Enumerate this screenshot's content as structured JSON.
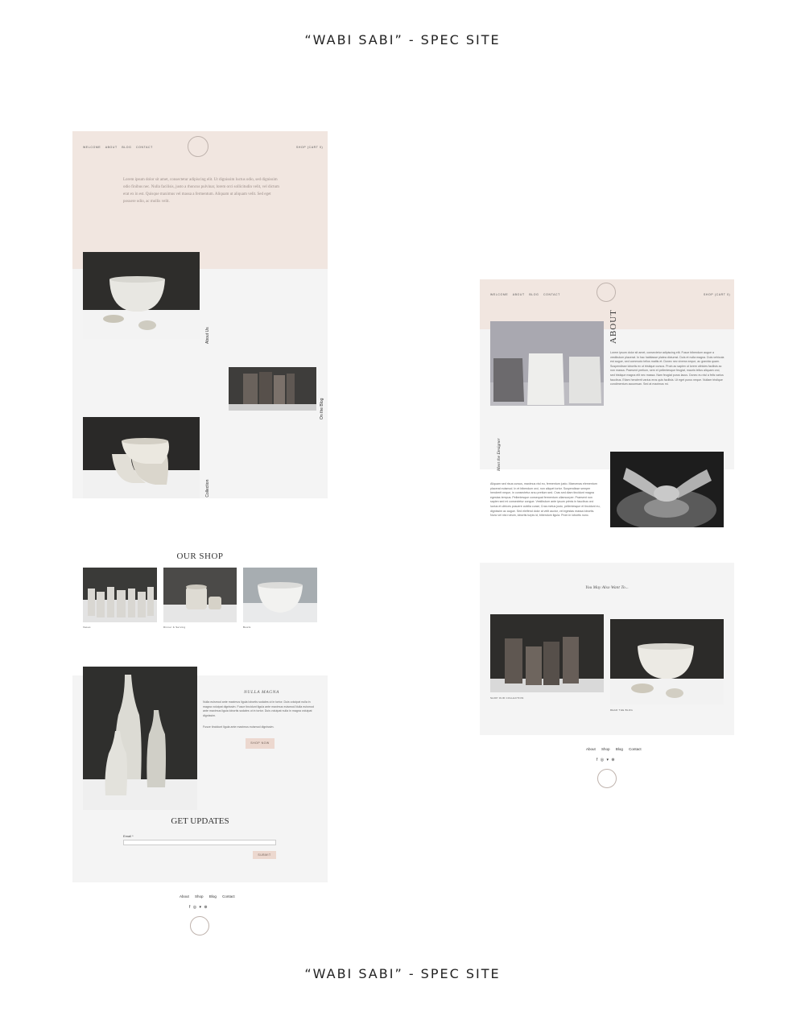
{
  "title": "“WABI SABI” - SPEC SITE",
  "nav": {
    "links": [
      "WELCOME",
      "ABOUT",
      "BLOG",
      "CONTACT"
    ],
    "right": "SHOP (CART 0)",
    "logo_text": "WABI SABI CERAMICS"
  },
  "home": {
    "intro": "Lorem ipsum dolor sit amet, consectetur adipiscing elit. Ut dignissim luctus odio, sed dignissim odio finibus nec. Nulla facilisis, justo a rhoncus pulvinar, lorem orci sollicitudin velit, vel dictum erat ex in est. Quisque maximus vel massa a fermentum. Aliquam ut aliquam velit. Sed eget posuere odio, ac mollis velit.",
    "label_about": "About Us",
    "label_blog": "On the Blog",
    "label_collection": "Shop the Collection",
    "shop_heading": "OUR SHOP",
    "shop_items": [
      "Vases",
      "Dinner & Serving",
      "Bowls"
    ],
    "feature_heading": "NULLA MAGNA",
    "feature_p1": "Nulla euismod ante maximus ligula lobortis sodales ut in tortor. Duis volutpat nulla in magna volutpat dignissim. Fusce tincidunt ligula ante maximus euismod.Nulla euismod ante maximus ligula lobortis sodales ut in tortor. Duis volutpat nulla in magna volutpat dignissim.",
    "feature_p2": "Fusce tincidunt ligula ante maximus euismod dignissim.",
    "shop_now": "SHOP NOW",
    "updates_heading": "GET UPDATES",
    "email_label": "Email *",
    "submit": "SUBMIT"
  },
  "about": {
    "heading": "ABOUT",
    "body": "Lorem ipsum dolor sit amet, consectetur adipiscing elit. Fusce bibendum augue a vestibulum placerat. In hac habitasse platea dictumst. Duis et nulla magna. Duis vehicula est augue, sed commodo tellus mattis et. Donec nec viverra neque, ac gravida quam. Suspendisse lobortis ex ut tristique cursus. Proin ac sapien ut lorem ultricies facilisis ac non massa. Praesent pretium, sem et pellentesque feugiat, mauris tellus aliquam orci, sed tristique magna elit nec massa. Nam feugiat purus lacus. Donec eu nisl a felis varius faucibus. Etiam hendrerit varius eros quis facilisis. Ut eget purus neque. Nullam tristique condimentum accumsan. Sed at maximus mi.",
    "designer_label": "Meet the Designer",
    "designer_body": "Aliquam sed risus cursus, maximus nisl eu, fermentum justo. Maecenas elementum placerat euismod. In et bibendum orci, non aliquet tortor. Suspendisse semper hendrerit neque, in consectetur arcu pretium sed. Cras sed diam tincidunt magna egestas tempus. Pellentesque consequat fermentum ullamcorper. Praesent non sapien sed mi consectetur congue. Vestibulum ante ipsum primis in faucibus orci luctus et ultrices posuere cubilia curae; Cras metus justo, pellentesque et tincidunt eu, dignissim ac augue. Sed eleifend dolor at velit auctor, vel egestas massa lobortis. Nunc vel nisi rutrum, lobortis turpis id, bibendum ligula. Proin in lobortis nunc.",
    "also_heading": "You May Also Want To...",
    "caption_collection": "SHOP OUR COLLECTION",
    "caption_blog": "READ THE BLOG"
  },
  "footer": {
    "links": [
      "About",
      "Shop",
      "Blog",
      "Contact"
    ],
    "social": "f ◎ ▾ ⊛",
    "badge": "WABI SABI"
  },
  "colors": {
    "blush": "#f1e6e0",
    "panel": "#f4f4f4",
    "button": "#ecd8cf"
  }
}
